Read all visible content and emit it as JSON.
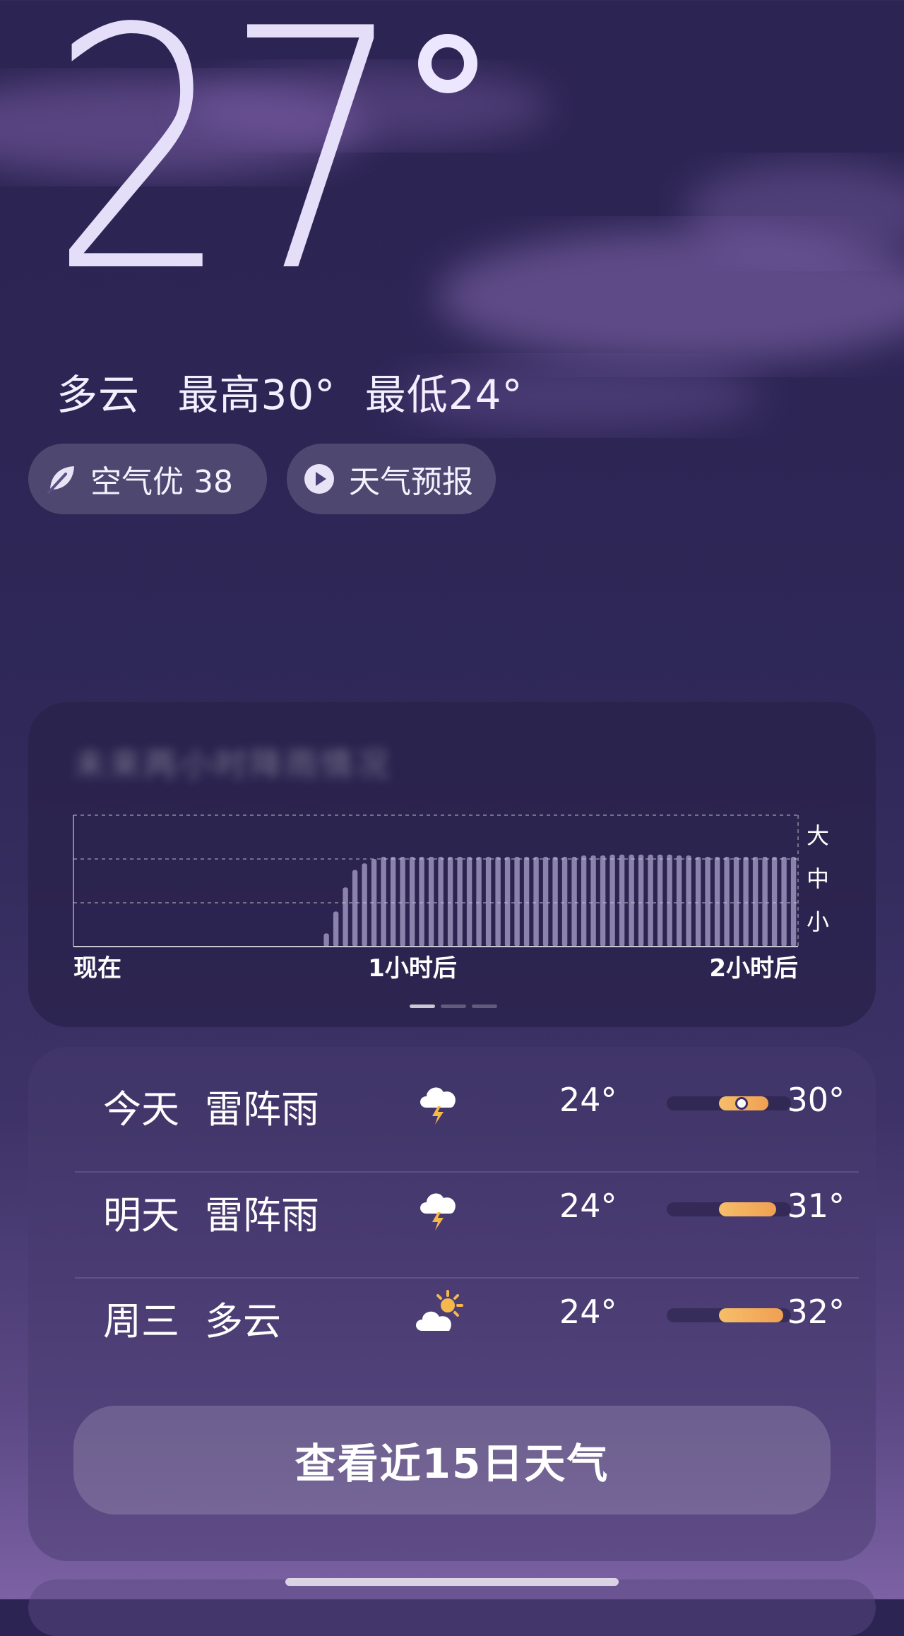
{
  "current": {
    "temperature": "27",
    "condition": "多云",
    "high": "最高30°",
    "low": "最低24°"
  },
  "chips": {
    "air_quality": "空气优 38",
    "forecast": "天气预报"
  },
  "rain": {
    "title": "未来两小时降雨情况",
    "level_labels": [
      "大",
      "中",
      "小"
    ],
    "time_labels": [
      "现在",
      "1小时后",
      "2小时后"
    ],
    "active_page": 0,
    "page_count": 3
  },
  "chart_data": {
    "type": "bar",
    "title": "",
    "xlabel": "",
    "ylabel": "",
    "x_ticks": [
      "现在",
      "1小时后",
      "2小时后"
    ],
    "y_ticks": [
      "小",
      "中",
      "大"
    ],
    "ylim": [
      0,
      3
    ],
    "grid": true,
    "values": [
      0,
      0,
      0,
      0,
      0,
      0,
      0,
      0,
      0,
      0,
      0,
      0,
      0,
      0,
      0,
      0,
      0,
      0,
      0,
      0,
      0,
      0,
      0,
      0,
      0,
      0,
      0.3,
      0.8,
      1.35,
      1.75,
      1.9,
      2.0,
      2.05,
      2.05,
      2.05,
      2.05,
      2.05,
      2.05,
      2.05,
      2.05,
      2.05,
      2.05,
      2.05,
      2.05,
      2.05,
      2.05,
      2.05,
      2.05,
      2.05,
      2.05,
      2.05,
      2.05,
      2.05,
      2.08,
      2.08,
      2.08,
      2.1,
      2.1,
      2.1,
      2.1,
      2.1,
      2.1,
      2.1,
      2.08,
      2.08,
      2.05,
      2.05,
      2.05,
      2.05,
      2.05,
      2.05,
      2.05,
      2.05,
      2.05,
      2.05,
      2.05
    ]
  },
  "daily": [
    {
      "day": "今天",
      "condition": "雷阵雨",
      "icon": "thunderstorm-icon",
      "low": "24°",
      "high": "30°",
      "bar_start": 0.42,
      "bar_end": 0.82,
      "now_pos": 0.6
    },
    {
      "day": "明天",
      "condition": "雷阵雨",
      "icon": "thunderstorm-icon",
      "low": "24°",
      "high": "31°",
      "bar_start": 0.42,
      "bar_end": 0.88
    },
    {
      "day": "周三",
      "condition": "多云",
      "icon": "partly-cloudy-icon",
      "low": "24°",
      "high": "32°",
      "bar_start": 0.42,
      "bar_end": 0.94
    }
  ],
  "button_15day": "查看近15日天气",
  "colors": {
    "accent_bar": "#f0a052",
    "background": "#2c2452"
  }
}
